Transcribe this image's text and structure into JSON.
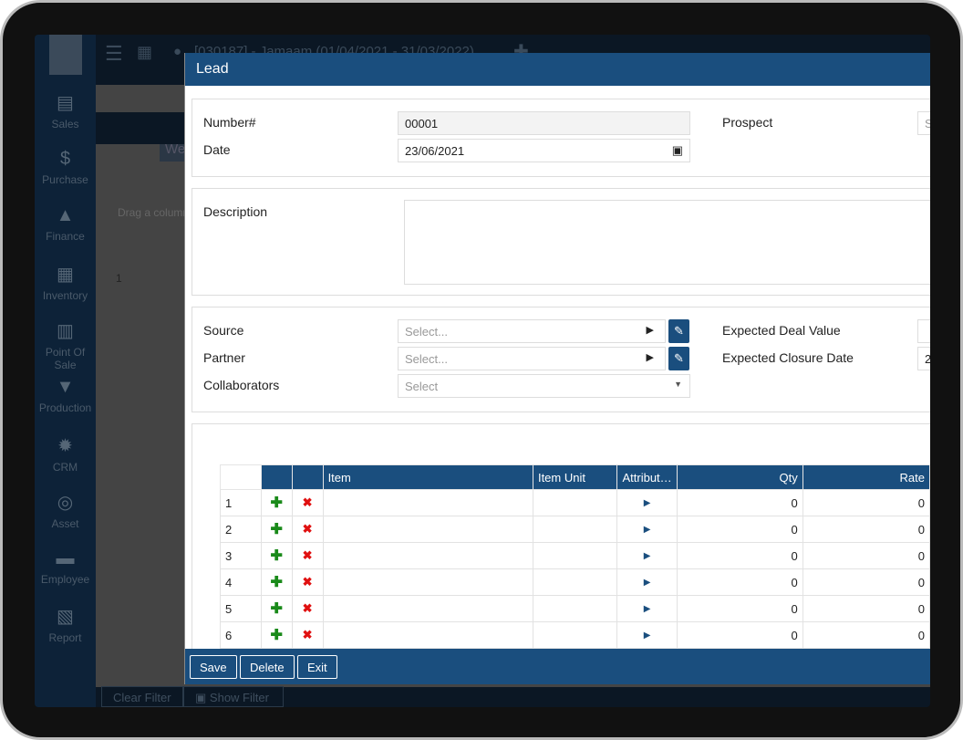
{
  "app": {
    "header_title": "[030187] - Jamaam (01/04/2021 - 31/03/2022)",
    "tab": "Welcome",
    "grid_hint": "Drag a column",
    "grid_row": "1",
    "clear_filter": "Clear Filter",
    "show_filter": "Show Filter"
  },
  "sidebar": {
    "items": [
      {
        "label": "Sales",
        "icon": "sales-icon"
      },
      {
        "label": "Purchase",
        "icon": "purchase-icon"
      },
      {
        "label": "Finance",
        "icon": "finance-icon"
      },
      {
        "label": "Inventory",
        "icon": "inventory-icon"
      },
      {
        "label": "Point Of Sale",
        "icon": "pos-icon"
      },
      {
        "label": "Production",
        "icon": "production-icon"
      },
      {
        "label": "CRM",
        "icon": "crm-icon"
      },
      {
        "label": "Asset",
        "icon": "asset-icon"
      },
      {
        "label": "Employee",
        "icon": "employee-icon"
      },
      {
        "label": "Report",
        "icon": "report-icon"
      }
    ]
  },
  "modal": {
    "title": "Lead",
    "number_label": "Number#",
    "number_value": "00001",
    "date_label": "Date",
    "date_value": "23/06/2021",
    "prospect_label": "Prospect",
    "prospect_placeholder": "S",
    "description_label": "Description",
    "source_label": "Source",
    "source_placeholder": "Select...",
    "partner_label": "Partner",
    "partner_placeholder": "Select...",
    "collaborators_label": "Collaborators",
    "collaborators_placeholder": "Select",
    "deal_value_label": "Expected Deal Value",
    "closure_date_label": "Expected Closure Date",
    "closure_date_value": "2",
    "table": {
      "headers": [
        "",
        "",
        "",
        "Item",
        "Item Unit",
        "Attribut…",
        "Qty",
        "Rate"
      ],
      "rows": [
        {
          "n": "1",
          "qty": "0",
          "rate": "0"
        },
        {
          "n": "2",
          "qty": "0",
          "rate": "0"
        },
        {
          "n": "3",
          "qty": "0",
          "rate": "0"
        },
        {
          "n": "4",
          "qty": "0",
          "rate": "0"
        },
        {
          "n": "5",
          "qty": "0",
          "rate": "0"
        },
        {
          "n": "6",
          "qty": "0",
          "rate": "0"
        }
      ]
    },
    "buttons": {
      "save": "Save",
      "delete": "Delete",
      "exit": "Exit"
    }
  },
  "colors": {
    "primary": "#1a4e7e",
    "add": "#1a8a1a",
    "remove": "#e01010"
  }
}
